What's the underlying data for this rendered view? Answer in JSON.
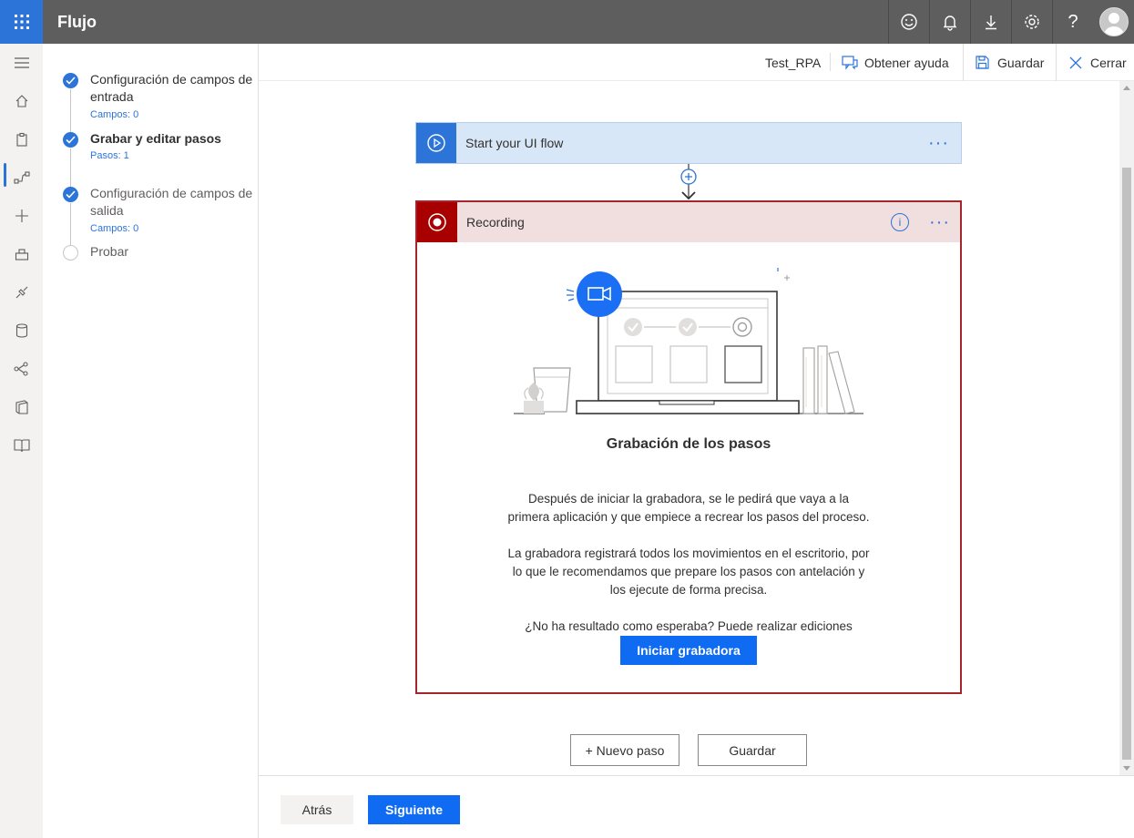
{
  "header": {
    "app_title": "Flujo",
    "icons": [
      "waffle-icon",
      "smiley-icon",
      "bell-icon",
      "download-icon",
      "gear-icon",
      "help-icon",
      "avatar"
    ],
    "help_glyph": "?"
  },
  "rail": {
    "items": [
      "menu-icon",
      "home-icon",
      "clipboard-icon",
      "flow-icon",
      "plus-icon",
      "templates-icon",
      "connectors-icon",
      "data-icon",
      "ai-icon",
      "solutions-icon",
      "learn-icon"
    ],
    "active_index": 3
  },
  "steps": [
    {
      "title": "Configuración de campos de entrada",
      "sub": "Campos: 0",
      "done": true,
      "bold": false
    },
    {
      "title": "Grabar y editar pasos",
      "sub": "Pasos: 1",
      "done": true,
      "bold": true
    },
    {
      "title": "Configuración de campos de salida",
      "sub": "Campos: 0",
      "done": true,
      "bold": false
    },
    {
      "title": "Probar",
      "sub": "",
      "done": false,
      "bold": false
    }
  ],
  "cmdbar": {
    "flow_name": "Test_RPA",
    "help_label": "Obtener ayuda",
    "save_label": "Guardar",
    "close_label": "Cerrar"
  },
  "canvas": {
    "start_card_title": "Start your UI flow",
    "more_dots": "···",
    "recording_title": "Recording",
    "info_glyph": "i",
    "rec_heading": "Grabación de los pasos",
    "rec_p1": "Después de iniciar la grabadora, se le pedirá que vaya a la primera aplicación y que empiece a recrear los pasos del proceso.",
    "rec_p2": "La grabadora registrará todos los movimientos en el escritorio, por lo que le recomendamos que prepare los pasos con antelación y los ejecute de forma precisa.",
    "rec_p3": "¿No ha resultado como esperaba? Puede realizar ediciones posteriores a la grabación, o bien puede eliminar la grabación y repetirla.",
    "start_recorder_label": "Iniciar grabadora",
    "new_step_label": "+ Nuevo paso",
    "save_label": "Guardar"
  },
  "footer": {
    "back_label": "Atrás",
    "next_label": "Siguiente"
  },
  "colors": {
    "accent": "#2c74d8",
    "topbar": "#5e5e5e",
    "recording_border": "#a4262c",
    "recording_header_bg": "#f1dede",
    "start_card_bg": "#d8e7f7",
    "primary_button": "#0f6cf2"
  }
}
